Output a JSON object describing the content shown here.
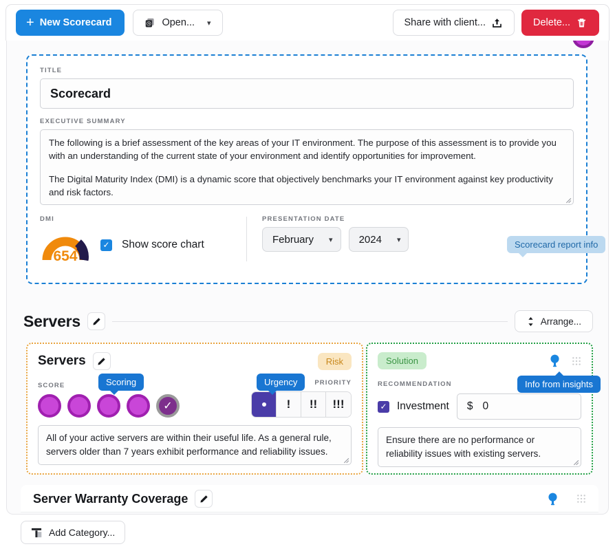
{
  "toolbar": {
    "new_scorecard": "New Scorecard",
    "open": "Open...",
    "share": "Share with client...",
    "delete": "Delete..."
  },
  "summary": {
    "title_label": "TITLE",
    "title_value": "Scorecard",
    "exec_label": "EXECUTIVE SUMMARY",
    "exec_p1": "The following is a brief assessment of the key areas of your IT environment. The purpose of this assessment is to provide you with an understanding of the current state of your environment and identify opportunities for improvement.",
    "exec_p2": "The Digital Maturity Index (DMI) is a dynamic score that objectively benchmarks your IT environment against key productivity and risk factors.",
    "dmi_label": "DMI",
    "dmi_score": "654",
    "show_score_chart": "Show score chart",
    "presentation_date_label": "PRESENTATION DATE",
    "month": "February",
    "year": "2024",
    "tooltip_report_info": "Scorecard report info"
  },
  "section": {
    "title": "Servers",
    "arrange": "Arrange..."
  },
  "server_card": {
    "title": "Servers",
    "risk_badge": "Risk",
    "score_label": "SCORE",
    "priority_label": "PRIORITY",
    "tooltip_scoring": "Scoring",
    "tooltip_urgency": "Urgency",
    "urgency_options": [
      "·",
      "!",
      "!!",
      "!!!"
    ],
    "urgency_selected_index": 0,
    "score_total": 5,
    "score_selected_index": 4,
    "note": "All of your active servers are within their useful life. As a general rule, servers older than 7 years exhibit performance and reliability issues."
  },
  "solution_card": {
    "solution_badge": "Solution",
    "recommendation_label": "RECOMMENDATION",
    "investment_label": "Investment",
    "investment_checked": true,
    "currency_symbol": "$",
    "investment_value": "0",
    "tooltip_info": "Info from insights",
    "note": "Ensure there are no performance or reliability issues with existing servers."
  },
  "warranty": {
    "title": "Server Warranty Coverage"
  },
  "footer": {
    "add_category": "Add Category..."
  },
  "colors": {
    "primary_blue": "#1a86e0",
    "danger_red": "#e0283f",
    "tooltip_blue": "#1976d2",
    "risk_orange": "#c8881c",
    "solution_green": "#3b9545",
    "score_purple": "#c946d8",
    "urgency_indigo": "#4a3ca8",
    "gauge_orange": "#f08a0c",
    "gauge_navy": "#221a4a",
    "risk_border": "#e8a33d",
    "solution_border": "#1f9e42",
    "summary_border": "#1a7fd4"
  },
  "icons": {
    "plus": "plus-icon",
    "open": "open-recent-icon",
    "share": "share-upload-icon",
    "delete": "trash-icon",
    "arrange": "sort-updown-icon",
    "edit": "pencil-icon",
    "insight": "lightbulb-icon",
    "grip": "drag-grip-icon",
    "add_category": "add-category-icon"
  }
}
